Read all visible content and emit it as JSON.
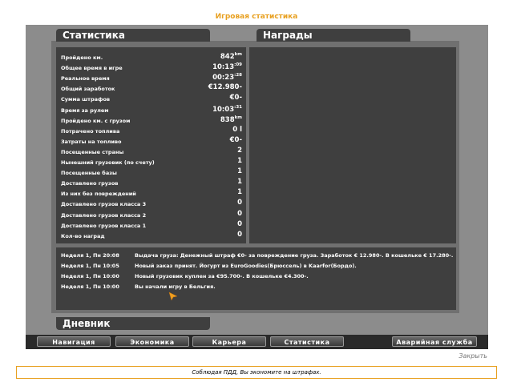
{
  "window_title": "Игровая статистика",
  "tabs": {
    "stats": "Статистика",
    "awards": "Награды",
    "diary": "Дневник"
  },
  "stats": [
    {
      "label": "Пройдено км.",
      "value": "842",
      "sup": "km"
    },
    {
      "label": "Общее время в игре",
      "value": "10:13",
      "sup": ":09"
    },
    {
      "label": "Реальное время",
      "value": "00:23",
      "sup": ":28"
    },
    {
      "label": "Общий заработок",
      "value": "€12.980-",
      "sup": ""
    },
    {
      "label": "Сумма штрафов",
      "value": "€0-",
      "sup": ""
    },
    {
      "label": "Время за рулем",
      "value": "10:03",
      "sup": ":31"
    },
    {
      "label": "Пройдено км. с грузом",
      "value": "838",
      "sup": "km"
    },
    {
      "label": "Потрачено топлива",
      "value": "0 l",
      "sup": ""
    },
    {
      "label": "Затраты на топливо",
      "value": "€0-",
      "sup": ""
    },
    {
      "label": "Посещенные страны",
      "value": "2",
      "sup": ""
    },
    {
      "label": "Нынешний грузовик (по счету)",
      "value": "1",
      "sup": ""
    },
    {
      "label": "Посещенные базы",
      "value": "1",
      "sup": ""
    },
    {
      "label": "Доставлено грузов",
      "value": "1",
      "sup": ""
    },
    {
      "label": "Из них без повреждений",
      "value": "1",
      "sup": ""
    },
    {
      "label": "Доставлено грузов класса 3",
      "value": "0",
      "sup": ""
    },
    {
      "label": "Доставлено грузов класса 2",
      "value": "0",
      "sup": ""
    },
    {
      "label": "Доставлено грузов класса 1",
      "value": "0",
      "sup": ""
    },
    {
      "label": "Кол-во наград",
      "value": "0",
      "sup": ""
    }
  ],
  "diary": [
    {
      "date": "Неделя 1, Пн 20:08",
      "text": "Выдача груза: Денежный штраф €0- за повреждение груза. Заработок € 12.980-. В кошельке € 17.280-."
    },
    {
      "date": "Неделя 1, Пн 10:05",
      "text": "Новый заказ принят. Йогурт из EuroGoodies(Брюссель) в Kaarfor(Бордо)."
    },
    {
      "date": "Неделя 1, Пн 10:00",
      "text": "Новый грузовик куплен за €95.700-. В кошельке €4.300-."
    },
    {
      "date": "Неделя 1, Пн 10:00",
      "text": "Вы начали игру в Бельгия."
    }
  ],
  "nav": [
    "Навигация",
    "Экономика",
    "Карьера",
    "Статистика"
  ],
  "emergency_button": "Аварийная служба",
  "close_label": "Закрыть",
  "tip": "Соблюдая ПДД, Вы экономите на штрафах.",
  "colors": {
    "title": "#e8a020",
    "panel": "#3f3f3f",
    "frame": "#8c8c8c"
  }
}
